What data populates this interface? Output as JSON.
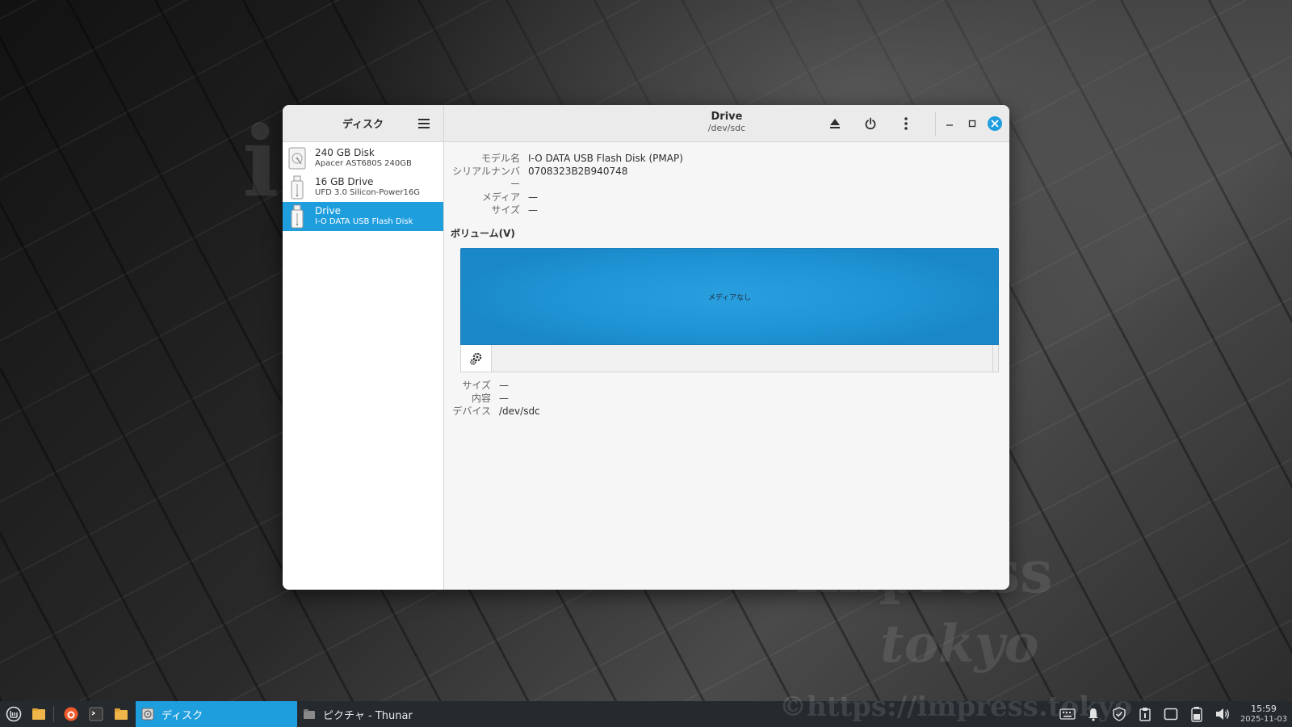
{
  "desktop": {
    "watermark_i": "i",
    "watermark_impress": "impress",
    "watermark_tokyo": "tokyo",
    "watermark_url": "©https://impress.tokyo"
  },
  "window": {
    "sidebar_title": "ディスク",
    "header_title": "Drive",
    "header_subtitle": "/dev/sdc",
    "disks": [
      {
        "name": "240 GB Disk",
        "sub": "Apacer AST680S 240GB",
        "icon": "hard-disk-icon",
        "selected": false
      },
      {
        "name": "16 GB Drive",
        "sub": "UFD 3.0 Silicon-Power16G",
        "icon": "usb-drive-icon",
        "selected": false
      },
      {
        "name": "Drive",
        "sub": "I-O DATA USB Flash Disk",
        "icon": "usb-drive-icon",
        "selected": true
      }
    ],
    "info": {
      "model_key": "モデル名",
      "model_val": "I-O DATA USB Flash Disk (PMAP)",
      "serial_key": "シリアルナンバー",
      "serial_val": "0708323B2B940748",
      "media_key": "メディア",
      "media_val": "—",
      "size_key": "サイズ",
      "size_val": "—"
    },
    "volumes_title": "ボリューム(V)",
    "volume_bar_label": "メディアなし",
    "volume_props": {
      "size_key": "サイズ",
      "size_val": "—",
      "content_key": "内容",
      "content_val": "—",
      "device_key": "デバイス",
      "device_val": "/dev/sdc"
    },
    "accent_color": "#1f9ede"
  },
  "taskbar": {
    "tasks": [
      {
        "label": "ディスク",
        "icon": "disks-app-icon",
        "active": true
      },
      {
        "label": "ピクチャ - Thunar",
        "icon": "folder-icon",
        "active": false
      }
    ],
    "clock_time": "15:59",
    "clock_date": "2025-11-03"
  }
}
